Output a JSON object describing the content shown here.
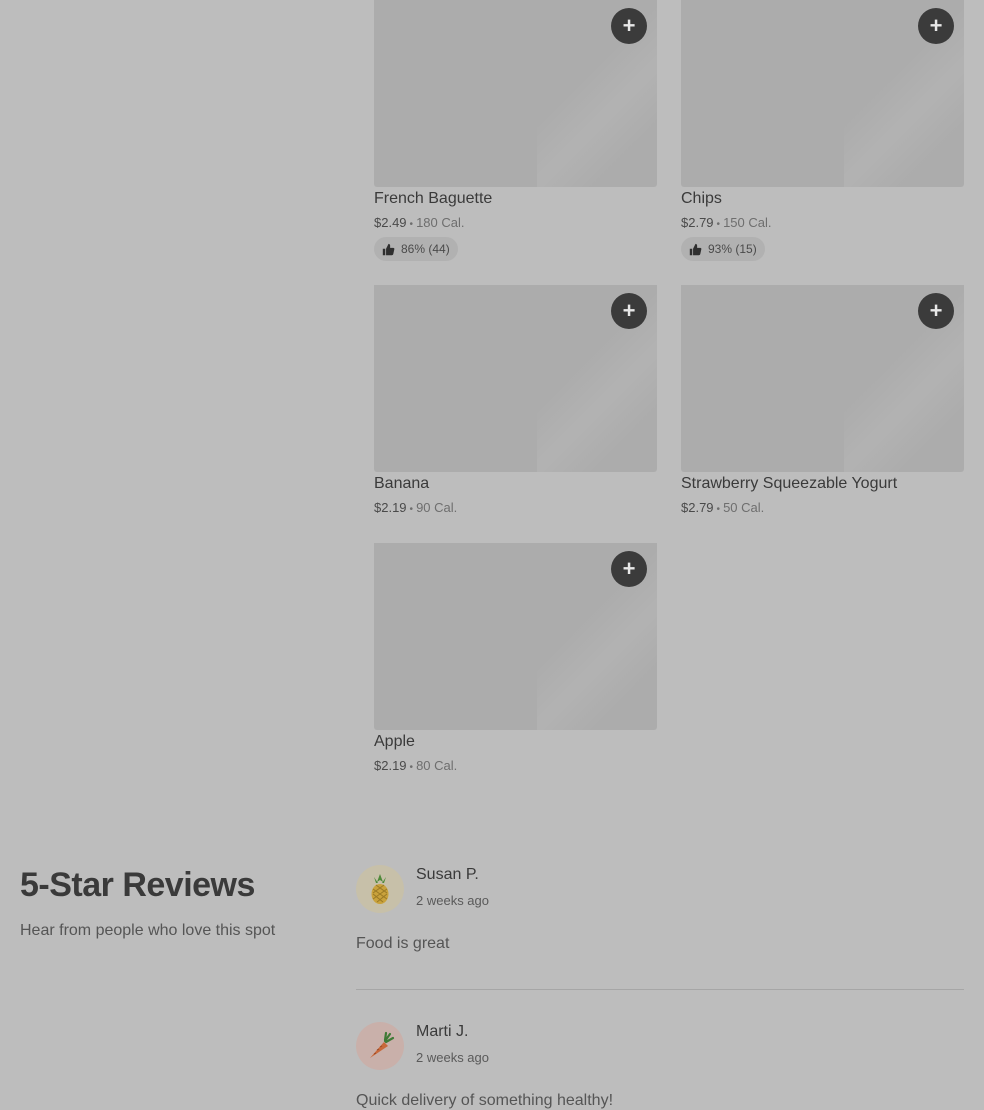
{
  "menu_items": [
    {
      "name": "French Baguette",
      "price": "$2.49",
      "calories": "180 Cal.",
      "rating": "86% (44)"
    },
    {
      "name": "Chips",
      "price": "$2.79",
      "calories": "150 Cal.",
      "rating": "93% (15)"
    },
    {
      "name": "Banana",
      "price": "$2.19",
      "calories": "90 Cal.",
      "rating": ""
    },
    {
      "name": "Strawberry Squeezable Yogurt",
      "price": "$2.79",
      "calories": "50 Cal.",
      "rating": ""
    },
    {
      "name": "Apple",
      "price": "$2.19",
      "calories": "80 Cal.",
      "rating": ""
    }
  ],
  "add_button_label": "+",
  "meta_separator": "•",
  "reviews": {
    "title": "5-Star Reviews",
    "subtitle": "Hear from people who love this spot",
    "items": [
      {
        "name": "Susan P.",
        "date": "2 weeks ago",
        "text": "Food is great",
        "avatar_icon": "pineapple-icon"
      },
      {
        "name": "Marti J.",
        "date": "2 weeks ago",
        "text": "Quick delivery of something healthy!",
        "avatar_icon": "carrot-icon"
      }
    ]
  }
}
